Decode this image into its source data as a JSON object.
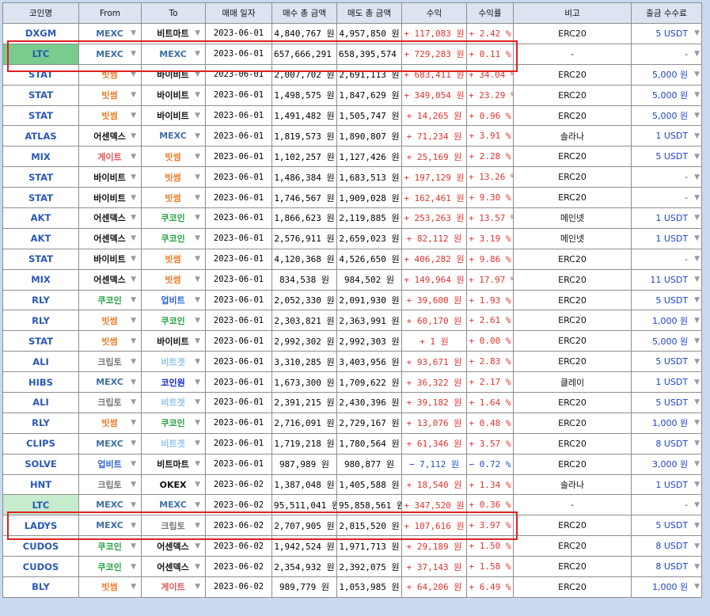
{
  "headers": [
    "코인명",
    "From",
    "To",
    "매매 일자",
    "매수 총 금액",
    "매도 총 금액",
    "수익",
    "수익률",
    "비고",
    "출금 수수료"
  ],
  "colors": {
    "MEXC": "#3e6fa1",
    "빗썸": "#f07a28",
    "바이비트": "#111111",
    "비트마트": "#111111",
    "어센덱스": "#111111",
    "게이트": "#e05555",
    "쿠코인": "#27a043",
    "업비트": "#2d65d6",
    "크립토": "#7a7a7a",
    "비트겟": "#8fc4ef",
    "코인원": "#1027d2",
    "OKEX": "#111111"
  },
  "rows": [
    {
      "coin": "DXGM",
      "from": "MEXC",
      "to": "비트마트",
      "date": "2023-06-01",
      "buy": "4,840,767 원",
      "sell": "4,957,850 원",
      "profit": "+ 117,083 원",
      "rate": "+ 2.42 %",
      "note": "ERC20",
      "fee": "5 USDT"
    },
    {
      "coin": "LTC",
      "from": "MEXC",
      "to": "MEXC",
      "date": "2023-06-01",
      "buy": "657,666,291 원",
      "sell": "658,395,574 원",
      "profit": "+ 729,283 원",
      "rate": "+ 0.11 %",
      "note": "-",
      "fee": "-",
      "hl": "hl"
    },
    {
      "coin": "STAT",
      "from": "빗썸",
      "to": "바이비트",
      "date": "2023-06-01",
      "buy": "2,007,702 원",
      "sell": "2,691,113 원",
      "profit": "+ 683,411 원",
      "rate": "+ 34.04 %",
      "note": "ERC20",
      "fee": "5,000 원"
    },
    {
      "coin": "STAT",
      "from": "빗썸",
      "to": "바이비트",
      "date": "2023-06-01",
      "buy": "1,498,575 원",
      "sell": "1,847,629 원",
      "profit": "+ 349,054 원",
      "rate": "+ 23.29 %",
      "note": "ERC20",
      "fee": "5,000 원"
    },
    {
      "coin": "STAT",
      "from": "빗썸",
      "to": "바이비트",
      "date": "2023-06-01",
      "buy": "1,491,482 원",
      "sell": "1,505,747 원",
      "profit": "+ 14,265 원",
      "rate": "+ 0.96 %",
      "note": "ERC20",
      "fee": "5,000 원"
    },
    {
      "coin": "ATLAS",
      "from": "어센덱스",
      "to": "MEXC",
      "date": "2023-06-01",
      "buy": "1,819,573 원",
      "sell": "1,890,807 원",
      "profit": "+ 71,234 원",
      "rate": "+ 3.91 %",
      "note": "솔라나",
      "fee": "1 USDT"
    },
    {
      "coin": "MIX",
      "from": "게이트",
      "to": "빗썸",
      "date": "2023-06-01",
      "buy": "1,102,257 원",
      "sell": "1,127,426 원",
      "profit": "+ 25,169 원",
      "rate": "+ 2.28 %",
      "note": "ERC20",
      "fee": "5 USDT"
    },
    {
      "coin": "STAT",
      "from": "바이비트",
      "to": "빗썸",
      "date": "2023-06-01",
      "buy": "1,486,384 원",
      "sell": "1,683,513 원",
      "profit": "+ 197,129 원",
      "rate": "+ 13.26 %",
      "note": "ERC20",
      "fee": "-"
    },
    {
      "coin": "STAT",
      "from": "바이비트",
      "to": "빗썸",
      "date": "2023-06-01",
      "buy": "1,746,567 원",
      "sell": "1,909,028 원",
      "profit": "+ 162,461 원",
      "rate": "+ 9.30 %",
      "note": "ERC20",
      "fee": "-"
    },
    {
      "coin": "AKT",
      "from": "어센덱스",
      "to": "쿠코인",
      "date": "2023-06-01",
      "buy": "1,866,623 원",
      "sell": "2,119,885 원",
      "profit": "+ 253,263 원",
      "rate": "+ 13.57 %",
      "note": "메인넷",
      "fee": "1 USDT"
    },
    {
      "coin": "AKT",
      "from": "어센덱스",
      "to": "쿠코인",
      "date": "2023-06-01",
      "buy": "2,576,911 원",
      "sell": "2,659,023 원",
      "profit": "+ 82,112 원",
      "rate": "+ 3.19 %",
      "note": "메인넷",
      "fee": "1 USDT"
    },
    {
      "coin": "STAT",
      "from": "바이비트",
      "to": "빗썸",
      "date": "2023-06-01",
      "buy": "4,120,368 원",
      "sell": "4,526,650 원",
      "profit": "+ 406,282 원",
      "rate": "+ 9.86 %",
      "note": "ERC20",
      "fee": "-"
    },
    {
      "coin": "MIX",
      "from": "어센덱스",
      "to": "빗썸",
      "date": "2023-06-01",
      "buy": "834,538 원",
      "sell": "984,502 원",
      "profit": "+ 149,964 원",
      "rate": "+ 17.97 %",
      "note": "ERC20",
      "fee": "11 USDT"
    },
    {
      "coin": "RLY",
      "from": "쿠코인",
      "to": "업비트",
      "date": "2023-06-01",
      "buy": "2,052,330 원",
      "sell": "2,091,930 원",
      "profit": "+ 39,600 원",
      "rate": "+ 1.93 %",
      "note": "ERC20",
      "fee": "5 USDT"
    },
    {
      "coin": "RLY",
      "from": "빗썸",
      "to": "쿠코인",
      "date": "2023-06-01",
      "buy": "2,303,821 원",
      "sell": "2,363,991 원",
      "profit": "+ 60,170 원",
      "rate": "+ 2.61 %",
      "note": "ERC20",
      "fee": "1,000 원"
    },
    {
      "coin": "STAT",
      "from": "빗썸",
      "to": "바이비트",
      "date": "2023-06-01",
      "buy": "2,992,302 원",
      "sell": "2,992,303 원",
      "profit": "+ 1 원",
      "rate": "+ 0.00 %",
      "note": "ERC20",
      "fee": "5,000 원"
    },
    {
      "coin": "ALI",
      "from": "크립토",
      "to": "비트겟",
      "date": "2023-06-01",
      "buy": "3,310,285 원",
      "sell": "3,403,956 원",
      "profit": "+ 93,671 원",
      "rate": "+ 2.83 %",
      "note": "ERC20",
      "fee": "5 USDT"
    },
    {
      "coin": "HIBS",
      "from": "MEXC",
      "to": "코인원",
      "date": "2023-06-01",
      "buy": "1,673,300 원",
      "sell": "1,709,622 원",
      "profit": "+ 36,322 원",
      "rate": "+ 2.17 %",
      "note": "클레이",
      "fee": "1 USDT"
    },
    {
      "coin": "ALI",
      "from": "크립토",
      "to": "비트겟",
      "date": "2023-06-01",
      "buy": "2,391,215 원",
      "sell": "2,430,396 원",
      "profit": "+ 39,182 원",
      "rate": "+ 1.64 %",
      "note": "ERC20",
      "fee": "5 USDT"
    },
    {
      "coin": "RLY",
      "from": "빗썸",
      "to": "쿠코인",
      "date": "2023-06-01",
      "buy": "2,716,091 원",
      "sell": "2,729,167 원",
      "profit": "+ 13,076 원",
      "rate": "+ 0.48 %",
      "note": "ERC20",
      "fee": "1,000 원"
    },
    {
      "coin": "CLIPS",
      "from": "MEXC",
      "to": "비트겟",
      "date": "2023-06-01",
      "buy": "1,719,218 원",
      "sell": "1,780,564 원",
      "profit": "+ 61,346 원",
      "rate": "+ 3.57 %",
      "note": "ERC20",
      "fee": "8 USDT"
    },
    {
      "coin": "SOLVE",
      "from": "업비트",
      "to": "비트마트",
      "date": "2023-06-01",
      "buy": "987,989 원",
      "sell": "980,877 원",
      "profit": "− 7,112 원",
      "rate": "− 0.72 %",
      "note": "ERC20",
      "fee": "3,000 원",
      "neg": true
    },
    {
      "coin": "HNT",
      "from": "크립토",
      "to": "OKEX",
      "date": "2023-06-02",
      "buy": "1,387,048 원",
      "sell": "1,405,588 원",
      "profit": "+ 18,540 원",
      "rate": "+ 1.34 %",
      "note": "솔라나",
      "fee": "1 USDT"
    },
    {
      "coin": "LTC",
      "from": "MEXC",
      "to": "MEXC",
      "date": "2023-06-02",
      "buy": "95,511,041 원",
      "sell": "95,858,561 원",
      "profit": "+ 347,520 원",
      "rate": "+ 0.36 %",
      "note": "-",
      "fee": "-",
      "hl": "hl2"
    },
    {
      "coin": "LADYS",
      "from": "MEXC",
      "to": "크립토",
      "date": "2023-06-02",
      "buy": "2,707,905 원",
      "sell": "2,815,520 원",
      "profit": "+ 107,616 원",
      "rate": "+ 3.97 %",
      "note": "ERC20",
      "fee": "5 USDT"
    },
    {
      "coin": "CUDOS",
      "from": "쿠코인",
      "to": "어센덱스",
      "date": "2023-06-02",
      "buy": "1,942,524 원",
      "sell": "1,971,713 원",
      "profit": "+ 29,189 원",
      "rate": "+ 1.50 %",
      "note": "ERC20",
      "fee": "8 USDT"
    },
    {
      "coin": "CUDOS",
      "from": "쿠코인",
      "to": "어센덱스",
      "date": "2023-06-02",
      "buy": "2,354,932 원",
      "sell": "2,392,075 원",
      "profit": "+ 37,143 원",
      "rate": "+ 1.58 %",
      "note": "ERC20",
      "fee": "8 USDT"
    },
    {
      "coin": "BLY",
      "from": "빗썸",
      "to": "게이트",
      "date": "2023-06-02",
      "buy": "989,779 원",
      "sell": "1,053,985 원",
      "profit": "+ 64,206 원",
      "rate": "+ 6.49 %",
      "note": "ERC20",
      "fee": "1,000 원"
    }
  ]
}
